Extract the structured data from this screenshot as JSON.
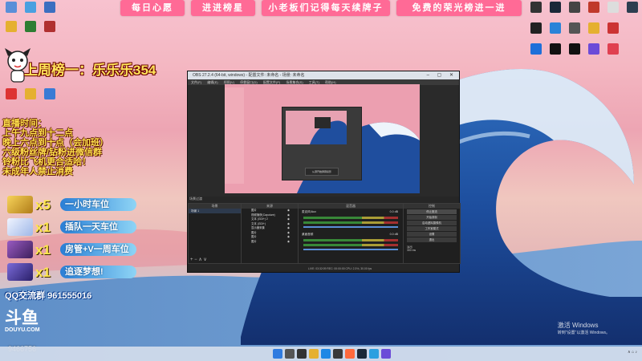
{
  "banners": [
    "每日心愿",
    "进进榜星",
    "小老板们记得每天续牌子",
    "免费的荣光榜进一进"
  ],
  "week_rank": "上周榜一：乐乐乐354",
  "schedule": [
    "直播时间：",
    "上午九点到十二点",
    "晚上六点到十点（会加班）",
    "六级粉丝牌/钻粉进微信群",
    "铃粉比飞机更合适哈！",
    "未成年人禁止消费"
  ],
  "rewards": [
    {
      "mult": "x5",
      "text": "一小时车位",
      "color": "#d9b03a"
    },
    {
      "mult": "x1",
      "text": "插队一天车位",
      "color": "#c7d6f0"
    },
    {
      "mult": "x1",
      "text": "房管+V一周车位",
      "color": "#6b3b8c"
    },
    {
      "mult": "x1",
      "text": "追逐梦想!",
      "color": "#5a3f9a"
    }
  ],
  "qq": "QQ交流群 961555016",
  "douyu": {
    "logo": "斗鱼",
    "sub": "DOUYU.COM"
  },
  "room_id": "9466756",
  "activate": {
    "line1": "激活 Windows",
    "line2": "转到\"设置\"以激活 Windows。"
  },
  "obs": {
    "title": "OBS 27.2.4 (64-bit, windows) - 配置文件: 未命名 - 场景: 未命名",
    "menu": [
      "文件(F)",
      "编辑(E)",
      "视图(V)",
      "停靠窗口(D)",
      "配置文件(P)",
      "场景集合(S)",
      "工具(T)",
      "帮助(H)"
    ],
    "nested_button": "从源开始屏幕投影",
    "panels": {
      "scenes": "场景",
      "sources": "来源",
      "mixer": "混音器",
      "controls": "控制"
    },
    "scene_selected": "场景 1",
    "scene_label": "场景过渡",
    "sources": [
      "图片",
      "视频捕获(Caputure)",
      "文本 (GDI+) 2",
      "文本 (GDI+)",
      "显示器采集",
      "图片",
      "图片",
      "图片"
    ],
    "mixer_tracks": [
      {
        "name": "麦克风/Aux",
        "db": "0.0 dB"
      },
      {
        "name": "桌面音频",
        "db": "0.0 dB"
      }
    ],
    "controls": [
      "停止推流",
      "开始录制",
      "启动虚拟摄像机",
      "工作室模式",
      "设置",
      "退出"
    ],
    "transition_label": "淡出",
    "duration": "300 ms",
    "status": "LIVE: 03:32:09   REC: 00:00:00   CPU: 2.3%, 30.00 fps"
  }
}
